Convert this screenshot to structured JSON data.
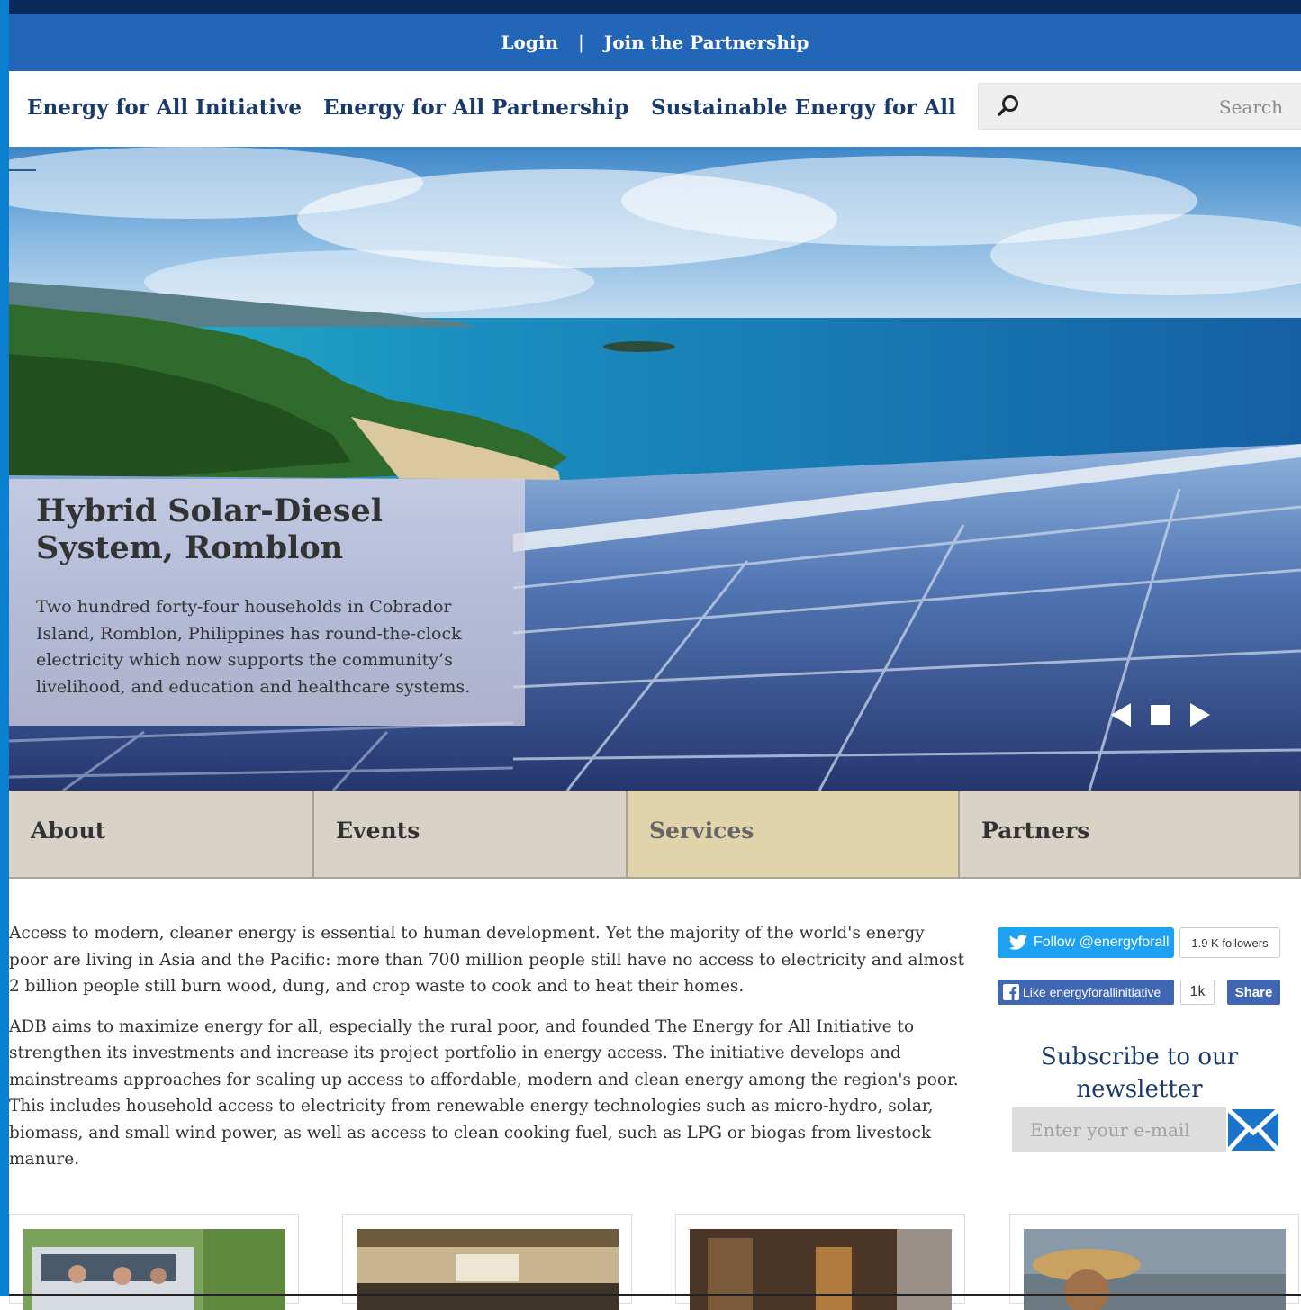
{
  "topbar": {
    "login": "Login",
    "separator": "|",
    "join": "Join the Partnership"
  },
  "nav": {
    "items": [
      "Energy for All Initiative",
      "Energy for All Partnership",
      "Sustainable Energy for All"
    ],
    "search_placeholder": "Search"
  },
  "hero": {
    "title": "Hybrid Solar-Diesel System, Romblon",
    "description": "Two hundred forty-four households in Cobrador Island, Romblon, Philippines has round-the-clock electricity which now supports the community’s livelihood, and education and healthcare systems."
  },
  "tabs": [
    "About",
    "Events",
    "Services",
    "Partners"
  ],
  "active_tab": "Services",
  "content": {
    "paragraphs": [
      "Access to modern, cleaner energy is essential to human development. Yet the majority of the world's energy poor are living in Asia and the Pacific: more than 700 million people still have no access to electricity and almost 2 billion people still burn wood, dung, and crop waste to cook and to heat their homes.",
      "ADB aims to maximize energy for all, especially the rural poor, and founded The Energy for All Initiative to strengthen its investments and increase its project portfolio in energy access. The initiative develops and mainstreams approaches for scaling up access to affordable, modern and clean energy among the region's poor. This includes household access to electricity from renewable energy technologies such as micro-hydro, solar, biomass, and small wind power, as well as access to clean cooking fuel, such as LPG or biogas from livestock manure."
    ]
  },
  "social": {
    "twitter_label": "Follow @energyforall",
    "twitter_count": "1.9 K followers",
    "fb_label": "Like energyforallinitiative",
    "fb_count": "1k",
    "fb_share": "Share"
  },
  "newsletter": {
    "title": "Subscribe to our newsletter",
    "placeholder": "Enter your e-mail"
  },
  "colors": {
    "topbar": "#2366b8",
    "nav_text": "#1a3a6b",
    "tab_bg": "#d8d3c6",
    "tab_active": "#e2d4aa"
  }
}
